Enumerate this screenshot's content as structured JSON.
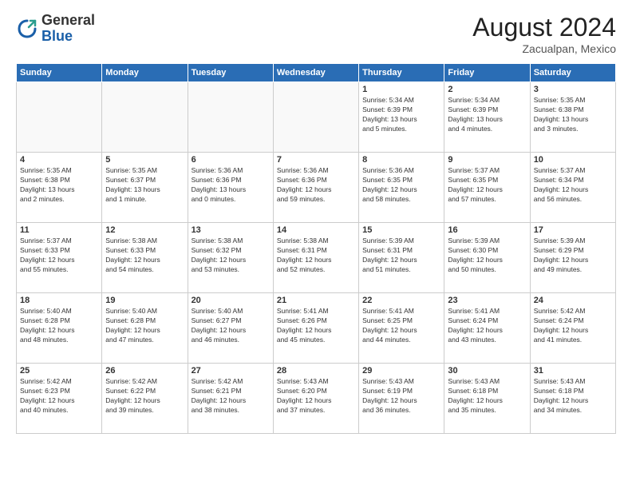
{
  "header": {
    "logo_general": "General",
    "logo_blue": "Blue",
    "month_year": "August 2024",
    "location": "Zacualpan, Mexico"
  },
  "days_of_week": [
    "Sunday",
    "Monday",
    "Tuesday",
    "Wednesday",
    "Thursday",
    "Friday",
    "Saturday"
  ],
  "weeks": [
    [
      {
        "day": "",
        "info": ""
      },
      {
        "day": "",
        "info": ""
      },
      {
        "day": "",
        "info": ""
      },
      {
        "day": "",
        "info": ""
      },
      {
        "day": "1",
        "info": "Sunrise: 5:34 AM\nSunset: 6:39 PM\nDaylight: 13 hours\nand 5 minutes."
      },
      {
        "day": "2",
        "info": "Sunrise: 5:34 AM\nSunset: 6:39 PM\nDaylight: 13 hours\nand 4 minutes."
      },
      {
        "day": "3",
        "info": "Sunrise: 5:35 AM\nSunset: 6:38 PM\nDaylight: 13 hours\nand 3 minutes."
      }
    ],
    [
      {
        "day": "4",
        "info": "Sunrise: 5:35 AM\nSunset: 6:38 PM\nDaylight: 13 hours\nand 2 minutes."
      },
      {
        "day": "5",
        "info": "Sunrise: 5:35 AM\nSunset: 6:37 PM\nDaylight: 13 hours\nand 1 minute."
      },
      {
        "day": "6",
        "info": "Sunrise: 5:36 AM\nSunset: 6:36 PM\nDaylight: 13 hours\nand 0 minutes."
      },
      {
        "day": "7",
        "info": "Sunrise: 5:36 AM\nSunset: 6:36 PM\nDaylight: 12 hours\nand 59 minutes."
      },
      {
        "day": "8",
        "info": "Sunrise: 5:36 AM\nSunset: 6:35 PM\nDaylight: 12 hours\nand 58 minutes."
      },
      {
        "day": "9",
        "info": "Sunrise: 5:37 AM\nSunset: 6:35 PM\nDaylight: 12 hours\nand 57 minutes."
      },
      {
        "day": "10",
        "info": "Sunrise: 5:37 AM\nSunset: 6:34 PM\nDaylight: 12 hours\nand 56 minutes."
      }
    ],
    [
      {
        "day": "11",
        "info": "Sunrise: 5:37 AM\nSunset: 6:33 PM\nDaylight: 12 hours\nand 55 minutes."
      },
      {
        "day": "12",
        "info": "Sunrise: 5:38 AM\nSunset: 6:33 PM\nDaylight: 12 hours\nand 54 minutes."
      },
      {
        "day": "13",
        "info": "Sunrise: 5:38 AM\nSunset: 6:32 PM\nDaylight: 12 hours\nand 53 minutes."
      },
      {
        "day": "14",
        "info": "Sunrise: 5:38 AM\nSunset: 6:31 PM\nDaylight: 12 hours\nand 52 minutes."
      },
      {
        "day": "15",
        "info": "Sunrise: 5:39 AM\nSunset: 6:31 PM\nDaylight: 12 hours\nand 51 minutes."
      },
      {
        "day": "16",
        "info": "Sunrise: 5:39 AM\nSunset: 6:30 PM\nDaylight: 12 hours\nand 50 minutes."
      },
      {
        "day": "17",
        "info": "Sunrise: 5:39 AM\nSunset: 6:29 PM\nDaylight: 12 hours\nand 49 minutes."
      }
    ],
    [
      {
        "day": "18",
        "info": "Sunrise: 5:40 AM\nSunset: 6:28 PM\nDaylight: 12 hours\nand 48 minutes."
      },
      {
        "day": "19",
        "info": "Sunrise: 5:40 AM\nSunset: 6:28 PM\nDaylight: 12 hours\nand 47 minutes."
      },
      {
        "day": "20",
        "info": "Sunrise: 5:40 AM\nSunset: 6:27 PM\nDaylight: 12 hours\nand 46 minutes."
      },
      {
        "day": "21",
        "info": "Sunrise: 5:41 AM\nSunset: 6:26 PM\nDaylight: 12 hours\nand 45 minutes."
      },
      {
        "day": "22",
        "info": "Sunrise: 5:41 AM\nSunset: 6:25 PM\nDaylight: 12 hours\nand 44 minutes."
      },
      {
        "day": "23",
        "info": "Sunrise: 5:41 AM\nSunset: 6:24 PM\nDaylight: 12 hours\nand 43 minutes."
      },
      {
        "day": "24",
        "info": "Sunrise: 5:42 AM\nSunset: 6:24 PM\nDaylight: 12 hours\nand 41 minutes."
      }
    ],
    [
      {
        "day": "25",
        "info": "Sunrise: 5:42 AM\nSunset: 6:23 PM\nDaylight: 12 hours\nand 40 minutes."
      },
      {
        "day": "26",
        "info": "Sunrise: 5:42 AM\nSunset: 6:22 PM\nDaylight: 12 hours\nand 39 minutes."
      },
      {
        "day": "27",
        "info": "Sunrise: 5:42 AM\nSunset: 6:21 PM\nDaylight: 12 hours\nand 38 minutes."
      },
      {
        "day": "28",
        "info": "Sunrise: 5:43 AM\nSunset: 6:20 PM\nDaylight: 12 hours\nand 37 minutes."
      },
      {
        "day": "29",
        "info": "Sunrise: 5:43 AM\nSunset: 6:19 PM\nDaylight: 12 hours\nand 36 minutes."
      },
      {
        "day": "30",
        "info": "Sunrise: 5:43 AM\nSunset: 6:18 PM\nDaylight: 12 hours\nand 35 minutes."
      },
      {
        "day": "31",
        "info": "Sunrise: 5:43 AM\nSunset: 6:18 PM\nDaylight: 12 hours\nand 34 minutes."
      }
    ]
  ]
}
